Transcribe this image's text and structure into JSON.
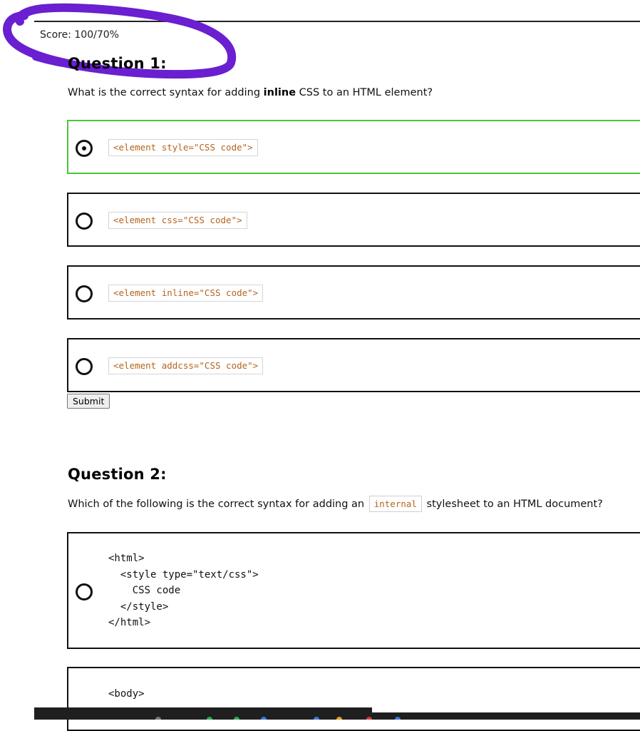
{
  "score": {
    "text": "Score: 100/70%"
  },
  "annotation": {
    "color": "#6a1fd0",
    "icon": "hand-drawn-circle"
  },
  "questions": [
    {
      "heading": "Question 1:",
      "prompt_before": "What is the correct syntax for adding ",
      "prompt_bold": "inline",
      "prompt_after": " CSS to an HTML element?",
      "options": [
        {
          "code": "<element style=\"CSS code\">",
          "selected": true
        },
        {
          "code": "<element css=\"CSS code\">",
          "selected": false
        },
        {
          "code": "<element inline=\"CSS code\">",
          "selected": false
        },
        {
          "code": "<element addcss=\"CSS code\">",
          "selected": false
        }
      ],
      "submit_label": "Submit"
    },
    {
      "heading": "Question 2:",
      "prompt_before": "Which of the following is the correct syntax for adding an ",
      "prompt_code": "internal",
      "prompt_after": " stylesheet to an HTML document?",
      "options": [
        {
          "code": "<html>\n  <style type=\"text/css\">\n    CSS code\n  </style>\n</html>",
          "selected": false
        },
        {
          "code": "<body>",
          "selected": false
        }
      ]
    }
  ],
  "colors": {
    "selected_border": "#4cc53a",
    "code_text": "#b5651d",
    "option_border": "#111111",
    "taskbar": "#1f1f1f"
  }
}
